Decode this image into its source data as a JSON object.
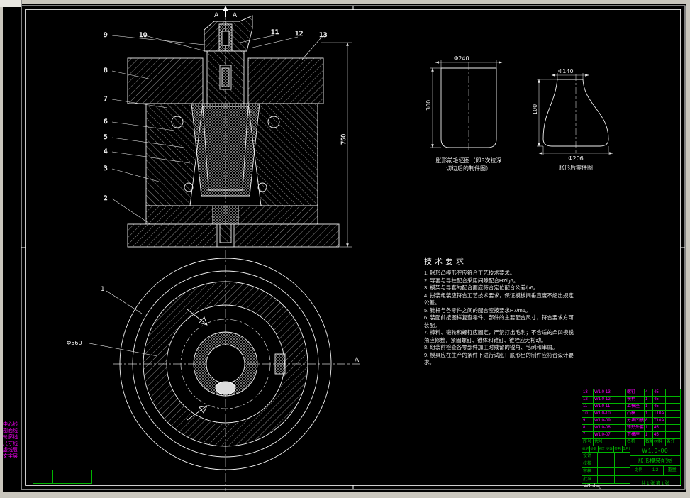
{
  "colors": {
    "background": "#000000",
    "chrome": "#c9c6bd",
    "line": "#ffffff",
    "green": "#00c800",
    "magenta": "#ff00ff"
  },
  "section_view": {
    "section_mark_left": "A",
    "section_mark_right": "A",
    "balloons_top": [
      "9",
      "10",
      "11",
      "12",
      "13"
    ],
    "balloons_left": [
      "8",
      "7",
      "6",
      "5",
      "4",
      "3",
      "2"
    ],
    "dim_height": "750"
  },
  "plan_view": {
    "balloon": "1",
    "dim_diameter": "Φ560",
    "section_arrow_label": "A"
  },
  "blank_before": {
    "dim_top": "Φ240",
    "dim_height": "300",
    "caption_line1": "胀形前毛坯图（即3次拉深",
    "caption_line2": "切边后的制件图）"
  },
  "blank_after": {
    "dim_top": "Φ140",
    "dim_height": "100",
    "dim_bottom": "Φ206",
    "caption": "胀形后零件图"
  },
  "tech_requirements": {
    "title": "技术要求",
    "items": [
      "1. 胀形凸模形腔应符合工艺技术要求。",
      "2. 导套与导柱配合采用间隙配合H7/g6。",
      "3. 模架与导套的配合面应符合定位配合公差/μ6。",
      "4. 拼装组装应符合工艺技术要求，保证模板间垂直度不超出规定公差。",
      "5. 锥杆与各零件之间的配合应按要求H7/m6。",
      "6. 装配前按图样复查零件、部件的主要配合尺寸，符合要求方可装配。",
      "7. 棒料、锻轮和螺钉应固定，严禁打出毛刺；不合适的凸凹模锐角应修整，紧固螺钉、锥体和锥钉、锥栓应无松动。",
      "8. 组装前检查各零部件加工时残留的锐角、毛刺和串屑。",
      "9. 模具应在生产的条件下进行试胀；胀形出的制件应符合设计要求。"
    ]
  },
  "bom": {
    "headers": [
      "序号",
      "代号",
      "名称",
      "数量",
      "材料",
      "备注"
    ],
    "rows": [
      {
        "seq": "13",
        "code": "W1.0-13",
        "name": "螺钉",
        "qty": "4",
        "mat": "45",
        "note": ""
      },
      {
        "seq": "12",
        "code": "W1.0-12",
        "name": "模柄",
        "qty": "1",
        "mat": "45",
        "note": ""
      },
      {
        "seq": "11",
        "code": "W1.0-11",
        "name": "上模座",
        "qty": "1",
        "mat": "45",
        "note": ""
      },
      {
        "seq": "10",
        "code": "W1.0-10",
        "name": "凸模",
        "qty": "1",
        "mat": "T10A",
        "note": ""
      },
      {
        "seq": "9",
        "code": "W1.0-09",
        "name": "分块凹模",
        "qty": "8",
        "mat": "T10A",
        "note": ""
      },
      {
        "seq": "8",
        "code": "W1.0-08",
        "name": "锥形外套",
        "qty": "1",
        "mat": "45",
        "note": ""
      },
      {
        "seq": "7",
        "code": "W1.0-07",
        "name": "下模座",
        "qty": "1",
        "mat": "45",
        "note": ""
      }
    ]
  },
  "title_block": {
    "revision_headers": [
      "标记",
      "处数",
      "分区",
      "更改文件号",
      "签名",
      "年月日"
    ],
    "sign_roles": [
      "设计",
      "校核",
      "审核",
      "批准"
    ],
    "drawing_no": "W1.0-00",
    "drawing_title": "胀形模装配图",
    "scale_label": "比例",
    "scale_value": "1:2",
    "weight_label": "重量",
    "sheet": "共 1 张  第 1 张",
    "file_label": "W1.dwg"
  },
  "layers": [
    "中心线",
    "剖面线",
    "轮廓线",
    "尺寸线",
    "虚线层",
    "文字层"
  ]
}
